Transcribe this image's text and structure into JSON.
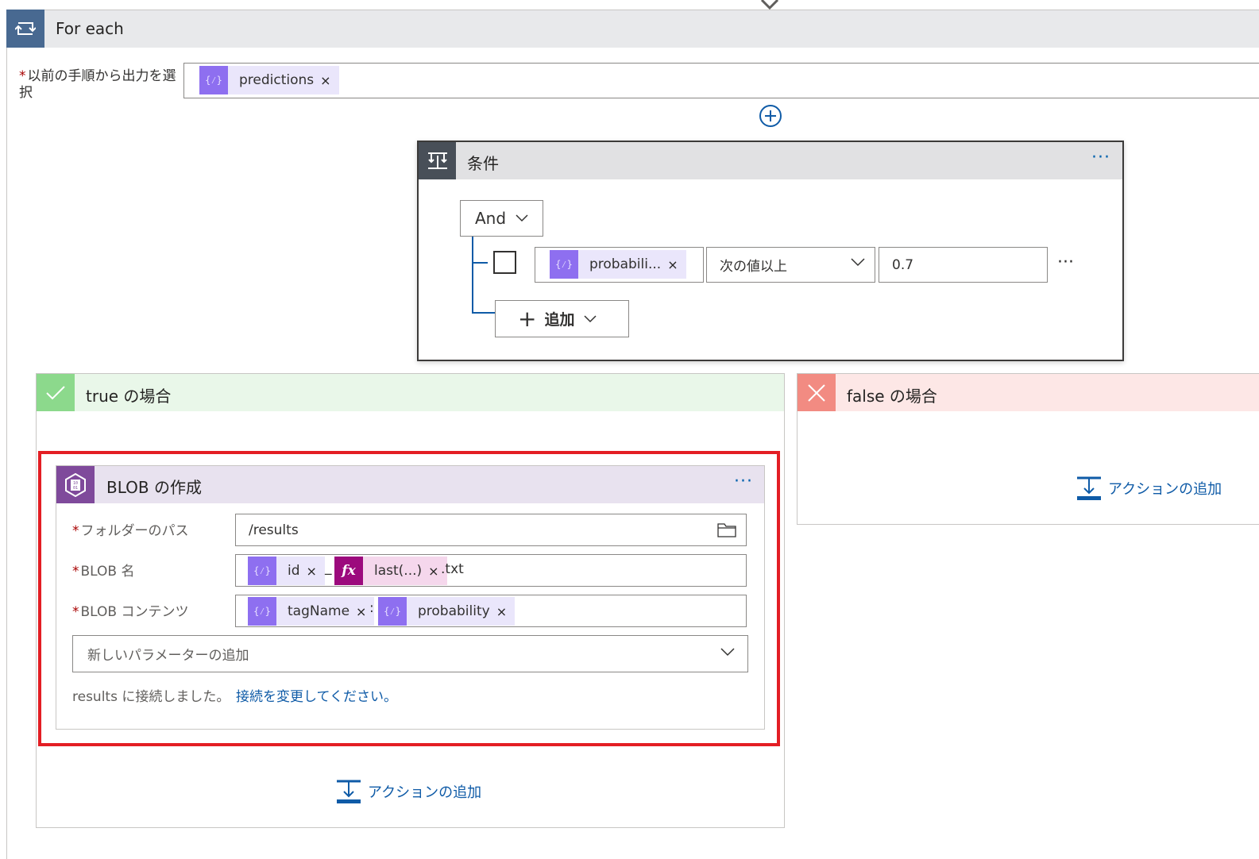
{
  "foreach": {
    "title": "For each",
    "select_label": "以前の手順から出力を選択",
    "required_mark": "*",
    "token": "predictions",
    "token_close": "×"
  },
  "condition": {
    "title": "条件",
    "menu": "···",
    "group_operator": "And",
    "row": {
      "field_token": "probabili...",
      "token_close": "×",
      "operator": "次の値以上",
      "value": "0.7",
      "menu": "···"
    },
    "add_button": "追加"
  },
  "true_branch": {
    "title": "true の場合",
    "add_action": "アクションの追加"
  },
  "false_branch": {
    "title": "false の場合",
    "add_action": "アクションの追加"
  },
  "blob": {
    "title": "BLOB の作成",
    "menu": "···",
    "folder_label": "フォルダーのパス",
    "folder_value": "/results",
    "name_label": "BLOB 名",
    "name_tokens": {
      "id": "id",
      "separator": "_",
      "fx_label": "fx",
      "fx": "last(...)",
      "suffix": ".txt"
    },
    "content_label": "BLOB コンテンツ",
    "content_tokens": {
      "tag": "tagName",
      "separator": ":",
      "prob": "probability"
    },
    "token_close": "×",
    "new_param_placeholder": "新しいパラメーターの追加",
    "connection_text": "results に接続しました。",
    "connection_link": "接続を変更してください。"
  },
  "colors": {
    "token_icon": "#8e6ff0",
    "fx_icon": "#9c0a7d",
    "highlight": "#e31e24",
    "link": "#0f5ba7"
  }
}
